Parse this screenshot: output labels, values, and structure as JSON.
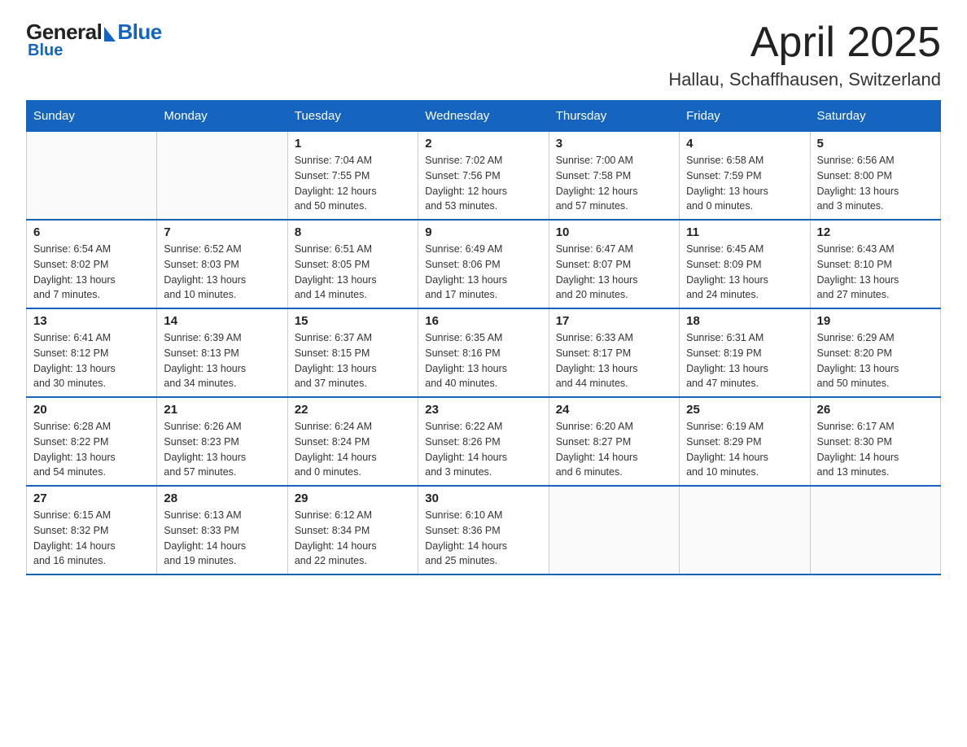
{
  "header": {
    "logo_general": "General",
    "logo_blue": "Blue",
    "main_title": "April 2025",
    "subtitle": "Hallau, Schaffhausen, Switzerland"
  },
  "calendar": {
    "weekdays": [
      "Sunday",
      "Monday",
      "Tuesday",
      "Wednesday",
      "Thursday",
      "Friday",
      "Saturday"
    ],
    "rows": [
      [
        {
          "day": "",
          "info": ""
        },
        {
          "day": "",
          "info": ""
        },
        {
          "day": "1",
          "info": "Sunrise: 7:04 AM\nSunset: 7:55 PM\nDaylight: 12 hours\nand 50 minutes."
        },
        {
          "day": "2",
          "info": "Sunrise: 7:02 AM\nSunset: 7:56 PM\nDaylight: 12 hours\nand 53 minutes."
        },
        {
          "day": "3",
          "info": "Sunrise: 7:00 AM\nSunset: 7:58 PM\nDaylight: 12 hours\nand 57 minutes."
        },
        {
          "day": "4",
          "info": "Sunrise: 6:58 AM\nSunset: 7:59 PM\nDaylight: 13 hours\nand 0 minutes."
        },
        {
          "day": "5",
          "info": "Sunrise: 6:56 AM\nSunset: 8:00 PM\nDaylight: 13 hours\nand 3 minutes."
        }
      ],
      [
        {
          "day": "6",
          "info": "Sunrise: 6:54 AM\nSunset: 8:02 PM\nDaylight: 13 hours\nand 7 minutes."
        },
        {
          "day": "7",
          "info": "Sunrise: 6:52 AM\nSunset: 8:03 PM\nDaylight: 13 hours\nand 10 minutes."
        },
        {
          "day": "8",
          "info": "Sunrise: 6:51 AM\nSunset: 8:05 PM\nDaylight: 13 hours\nand 14 minutes."
        },
        {
          "day": "9",
          "info": "Sunrise: 6:49 AM\nSunset: 8:06 PM\nDaylight: 13 hours\nand 17 minutes."
        },
        {
          "day": "10",
          "info": "Sunrise: 6:47 AM\nSunset: 8:07 PM\nDaylight: 13 hours\nand 20 minutes."
        },
        {
          "day": "11",
          "info": "Sunrise: 6:45 AM\nSunset: 8:09 PM\nDaylight: 13 hours\nand 24 minutes."
        },
        {
          "day": "12",
          "info": "Sunrise: 6:43 AM\nSunset: 8:10 PM\nDaylight: 13 hours\nand 27 minutes."
        }
      ],
      [
        {
          "day": "13",
          "info": "Sunrise: 6:41 AM\nSunset: 8:12 PM\nDaylight: 13 hours\nand 30 minutes."
        },
        {
          "day": "14",
          "info": "Sunrise: 6:39 AM\nSunset: 8:13 PM\nDaylight: 13 hours\nand 34 minutes."
        },
        {
          "day": "15",
          "info": "Sunrise: 6:37 AM\nSunset: 8:15 PM\nDaylight: 13 hours\nand 37 minutes."
        },
        {
          "day": "16",
          "info": "Sunrise: 6:35 AM\nSunset: 8:16 PM\nDaylight: 13 hours\nand 40 minutes."
        },
        {
          "day": "17",
          "info": "Sunrise: 6:33 AM\nSunset: 8:17 PM\nDaylight: 13 hours\nand 44 minutes."
        },
        {
          "day": "18",
          "info": "Sunrise: 6:31 AM\nSunset: 8:19 PM\nDaylight: 13 hours\nand 47 minutes."
        },
        {
          "day": "19",
          "info": "Sunrise: 6:29 AM\nSunset: 8:20 PM\nDaylight: 13 hours\nand 50 minutes."
        }
      ],
      [
        {
          "day": "20",
          "info": "Sunrise: 6:28 AM\nSunset: 8:22 PM\nDaylight: 13 hours\nand 54 minutes."
        },
        {
          "day": "21",
          "info": "Sunrise: 6:26 AM\nSunset: 8:23 PM\nDaylight: 13 hours\nand 57 minutes."
        },
        {
          "day": "22",
          "info": "Sunrise: 6:24 AM\nSunset: 8:24 PM\nDaylight: 14 hours\nand 0 minutes."
        },
        {
          "day": "23",
          "info": "Sunrise: 6:22 AM\nSunset: 8:26 PM\nDaylight: 14 hours\nand 3 minutes."
        },
        {
          "day": "24",
          "info": "Sunrise: 6:20 AM\nSunset: 8:27 PM\nDaylight: 14 hours\nand 6 minutes."
        },
        {
          "day": "25",
          "info": "Sunrise: 6:19 AM\nSunset: 8:29 PM\nDaylight: 14 hours\nand 10 minutes."
        },
        {
          "day": "26",
          "info": "Sunrise: 6:17 AM\nSunset: 8:30 PM\nDaylight: 14 hours\nand 13 minutes."
        }
      ],
      [
        {
          "day": "27",
          "info": "Sunrise: 6:15 AM\nSunset: 8:32 PM\nDaylight: 14 hours\nand 16 minutes."
        },
        {
          "day": "28",
          "info": "Sunrise: 6:13 AM\nSunset: 8:33 PM\nDaylight: 14 hours\nand 19 minutes."
        },
        {
          "day": "29",
          "info": "Sunrise: 6:12 AM\nSunset: 8:34 PM\nDaylight: 14 hours\nand 22 minutes."
        },
        {
          "day": "30",
          "info": "Sunrise: 6:10 AM\nSunset: 8:36 PM\nDaylight: 14 hours\nand 25 minutes."
        },
        {
          "day": "",
          "info": ""
        },
        {
          "day": "",
          "info": ""
        },
        {
          "day": "",
          "info": ""
        }
      ]
    ]
  }
}
